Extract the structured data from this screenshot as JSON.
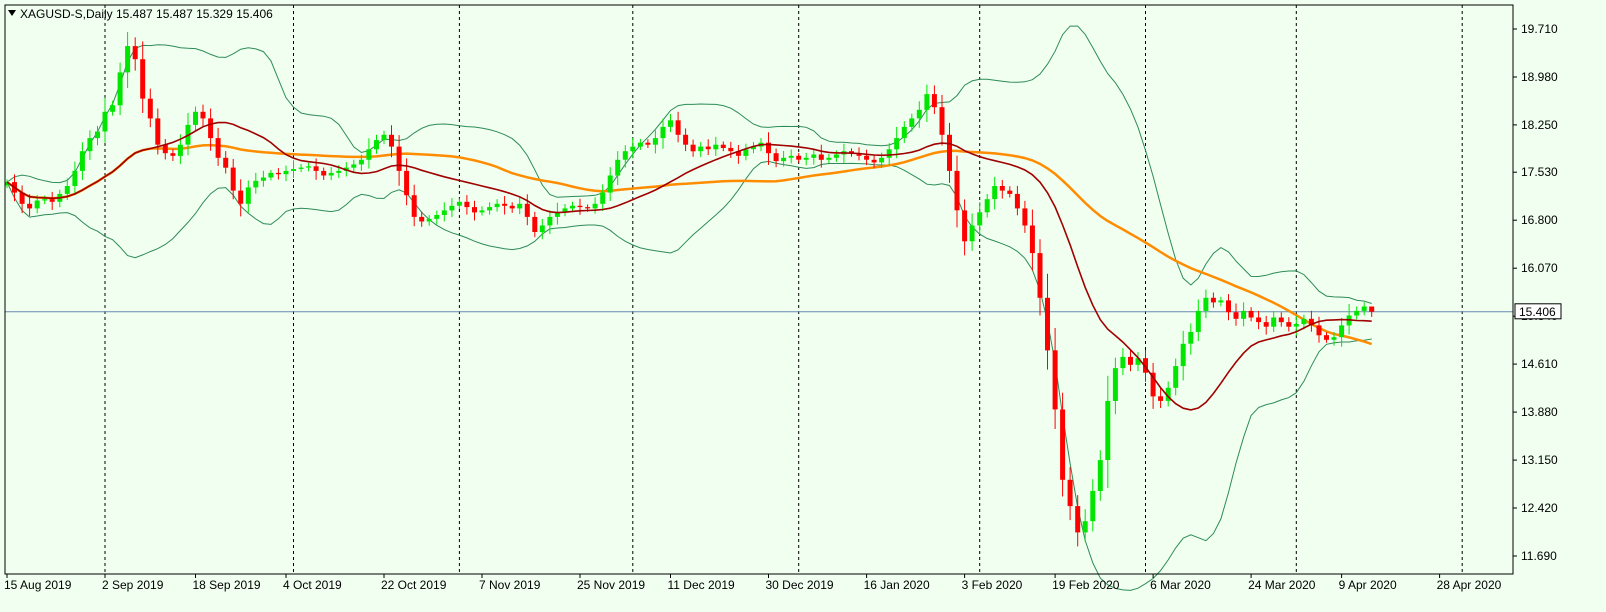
{
  "header": {
    "symbol_label": "XAGUSD-S,Daily",
    "ohlc": "15.487 15.487 15.329 15.406"
  },
  "current_price_label": "15.406",
  "colors": {
    "background": "#f0fff0",
    "bull": "#00e600",
    "bear": "#ff0000",
    "ma_fast": "#a00000",
    "ma_slow": "#ff8c00",
    "bands": "#2e8b57",
    "grid": "#000000",
    "price_line": "#6a8caf"
  },
  "chart_data": {
    "type": "candlestick",
    "title": "XAGUSD-S,Daily",
    "last_ohlc": {
      "open": 15.487,
      "high": 15.487,
      "low": 15.329,
      "close": 15.406
    },
    "current_price": 15.406,
    "ylim": [
      11.4,
      20.1
    ],
    "y_ticks": [
      "19.710",
      "18.980",
      "18.250",
      "17.530",
      "16.800",
      "16.070",
      "15.340",
      "14.610",
      "13.880",
      "13.150",
      "12.420",
      "11.690"
    ],
    "x_labels": [
      "15 Aug 2019",
      "2 Sep 2019",
      "18 Sep 2019",
      "4 Oct 2019",
      "22 Oct 2019",
      "7 Nov 2019",
      "25 Nov 2019",
      "11 Dec 2019",
      "30 Dec 2019",
      "16 Jan 2020",
      "3 Feb 2020",
      "19 Feb 2020",
      "6 Mar 2020",
      "24 Mar 2020",
      "9 Apr 2020",
      "28 Apr 2020"
    ],
    "x_label_index": [
      0,
      13,
      25,
      37,
      50,
      63,
      76,
      88,
      101,
      114,
      127,
      139,
      152,
      165,
      177,
      190
    ],
    "period_separators_index": [
      13,
      38,
      60,
      83,
      105,
      129,
      151,
      171,
      193
    ],
    "indicators": [
      "Bollinger Bands (20)",
      "MA 20 (dark red)",
      "MA 50 (orange)"
    ],
    "closes": [
      17.38,
      17.22,
      17.05,
      16.98,
      17.1,
      17.12,
      17.08,
      17.2,
      17.32,
      17.55,
      17.85,
      18.05,
      18.15,
      18.45,
      18.55,
      19.05,
      19.45,
      19.25,
      18.65,
      18.35,
      17.95,
      17.82,
      17.78,
      17.95,
      18.25,
      18.45,
      18.35,
      18.05,
      17.75,
      17.6,
      17.25,
      17.05,
      17.3,
      17.4,
      17.45,
      17.52,
      17.5,
      17.55,
      17.58,
      17.6,
      17.62,
      17.55,
      17.48,
      17.52,
      17.55,
      17.6,
      17.65,
      17.72,
      17.88,
      18.02,
      18.1,
      17.92,
      17.55,
      17.18,
      16.85,
      16.78,
      16.82,
      16.88,
      16.95,
      17.02,
      17.08,
      17.0,
      16.92,
      16.95,
      17.0,
      17.05,
      17.02,
      16.98,
      17.05,
      16.85,
      16.62,
      16.72,
      16.85,
      16.92,
      16.98,
      17.02,
      17.0,
      16.98,
      17.05,
      17.22,
      17.48,
      17.72,
      17.85,
      17.92,
      17.98,
      17.95,
      18.05,
      18.22,
      18.32,
      18.1,
      17.95,
      17.85,
      17.92,
      17.88,
      17.95,
      17.9,
      17.85,
      17.78,
      17.88,
      17.92,
      17.98,
      17.82,
      17.7,
      17.75,
      17.78,
      17.72,
      17.75,
      17.8,
      17.72,
      17.75,
      17.8,
      17.85,
      17.82,
      17.78,
      17.72,
      17.68,
      17.75,
      17.88,
      18.05,
      18.22,
      18.35,
      18.48,
      18.72,
      18.52,
      18.1,
      17.55,
      16.95,
      16.48,
      16.72,
      16.92,
      17.12,
      17.32,
      17.25,
      17.2,
      16.98,
      16.72,
      16.3,
      15.62,
      14.82,
      13.92,
      12.85,
      12.45,
      12.05,
      12.22,
      12.68,
      13.15,
      14.05,
      14.55,
      14.72,
      14.6,
      14.7,
      14.48,
      14.12,
      14.05,
      14.25,
      14.58,
      14.92,
      15.1,
      15.42,
      15.62,
      15.55,
      15.58,
      15.4,
      15.3,
      15.42,
      15.32,
      15.25,
      15.18,
      15.32,
      15.25,
      15.18,
      15.22,
      15.3,
      15.2,
      15.05,
      14.98,
      15.02,
      15.2,
      15.35,
      15.42,
      15.487,
      15.406
    ],
    "ma20_description": "20-period moving average of close",
    "ma50_description": "50-period moving average of close"
  }
}
